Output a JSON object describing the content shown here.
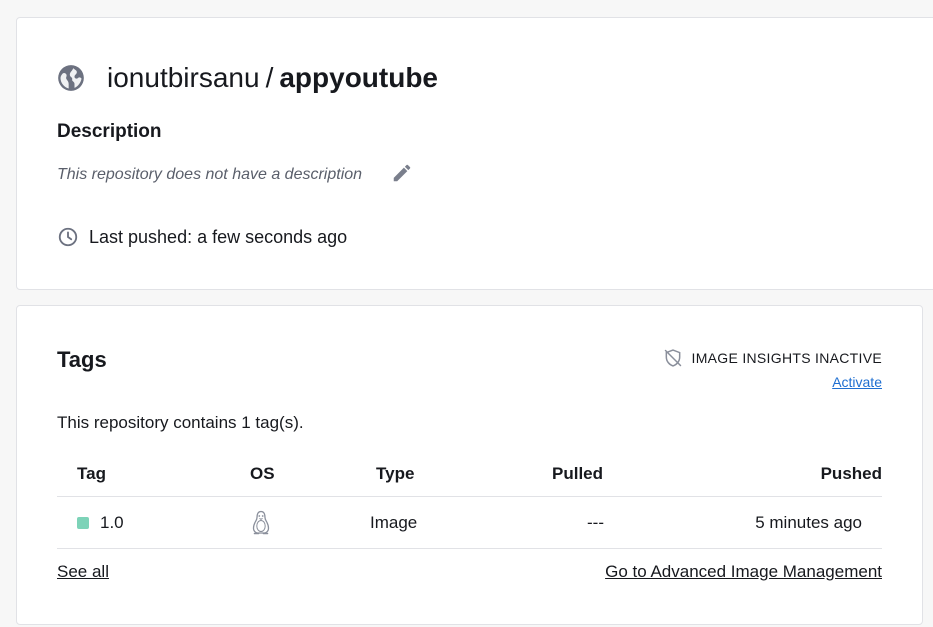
{
  "repo": {
    "namespace": "ionutbirsanu",
    "separator": "/",
    "name": "appyoutube",
    "description_heading": "Description",
    "description_text": "This repository does not have a description",
    "last_pushed": "Last pushed: a few seconds ago"
  },
  "tags": {
    "heading": "Tags",
    "insights_label": "IMAGE INSIGHTS INACTIVE",
    "activate_label": "Activate",
    "count_text": "This repository contains 1 tag(s).",
    "columns": [
      "Tag",
      "OS",
      "Type",
      "Pulled",
      "Pushed"
    ],
    "rows": [
      {
        "tag": "1.0",
        "os_icon": "linux-icon",
        "type": "Image",
        "pulled": "---",
        "pushed": "5 minutes ago",
        "tag_color": "#7dd3b8"
      }
    ],
    "see_all_label": "See all",
    "advanced_label": "Go to Advanced Image Management"
  },
  "colors": {
    "accent_link": "#1f6fd1",
    "tag_status": "#7dd3b8",
    "icon_gray": "#6c7180"
  }
}
